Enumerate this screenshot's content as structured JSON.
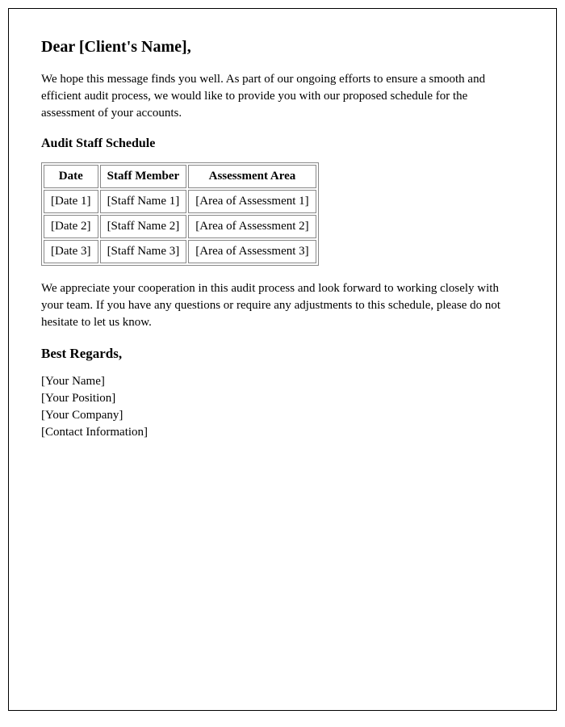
{
  "greeting": "Dear [Client's Name],",
  "intro_paragraph": "We hope this message finds you well. As part of our ongoing efforts to ensure a smooth and efficient audit process, we would like to provide you with our proposed schedule for the assessment of your accounts.",
  "schedule_heading": "Audit Staff Schedule",
  "table": {
    "headers": [
      "Date",
      "Staff Member",
      "Assessment Area"
    ],
    "rows": [
      [
        "[Date 1]",
        "[Staff Name 1]",
        "[Area of Assessment 1]"
      ],
      [
        "[Date 2]",
        "[Staff Name 2]",
        "[Area of Assessment 2]"
      ],
      [
        "[Date 3]",
        "[Staff Name 3]",
        "[Area of Assessment 3]"
      ]
    ]
  },
  "closing_paragraph": "We appreciate your cooperation in this audit process and look forward to working closely with your team. If you have any questions or require any adjustments to this schedule, please do not hesitate to let us know.",
  "signoff": "Best Regards,",
  "signature": {
    "name": "[Your Name]",
    "position": "[Your Position]",
    "company": "[Your Company]",
    "contact": "[Contact Information]"
  }
}
